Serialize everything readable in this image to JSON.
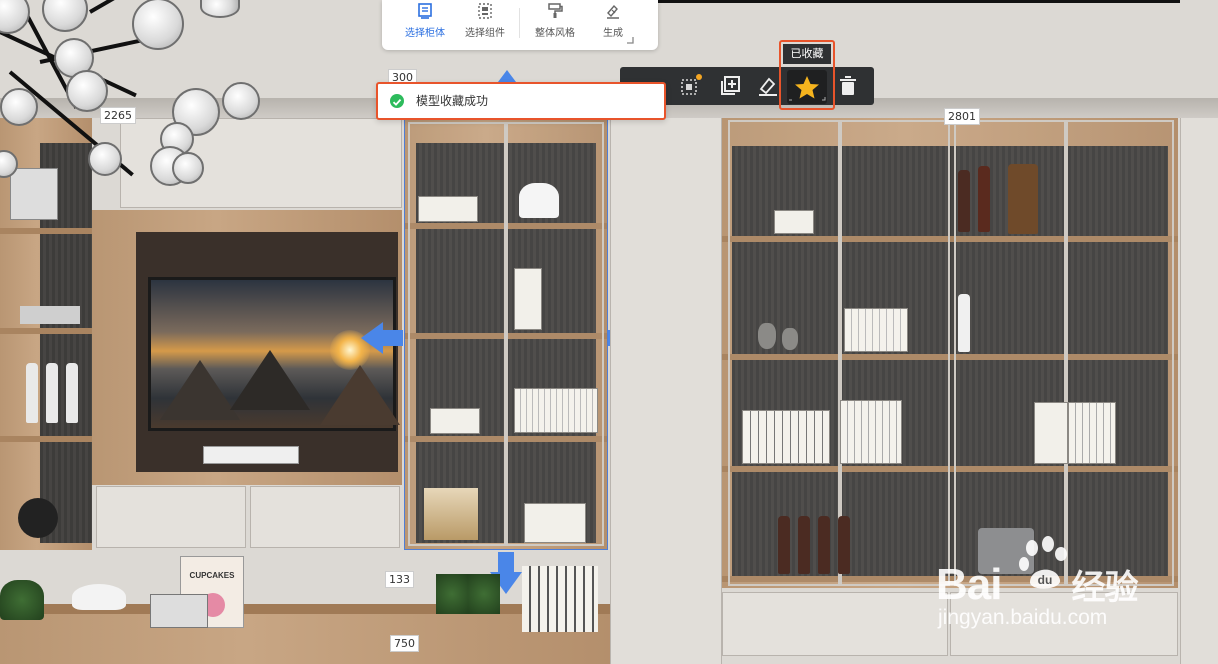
{
  "top_toolbar": {
    "items": [
      {
        "label": "选择柜体",
        "icon": "cabinet-select-icon",
        "active": true
      },
      {
        "label": "选择组件",
        "icon": "component-select-icon",
        "active": false
      },
      {
        "label": "整体风格",
        "icon": "paint-roller-icon",
        "active": false
      },
      {
        "label": "生成",
        "icon": "generate-icon",
        "active": false
      }
    ]
  },
  "float_toolbar": {
    "buttons": [
      "grid-icon",
      "frame-select-icon",
      "add-copy-icon",
      "brush-icon",
      "star-icon",
      "trash-icon"
    ],
    "favorite_tooltip": "已收藏"
  },
  "toast": {
    "message": "模型收藏成功",
    "icon": "check-circle-icon"
  },
  "dimensions": {
    "top_mid": "300",
    "left": "2265",
    "right": "2801",
    "bottom_gap": "133",
    "bottom_width": "750"
  },
  "scene": {
    "book_title": "CUPCAKES"
  },
  "watermark": {
    "brand": "Bai",
    "brand_cn": "经验",
    "brand_suffix": "du",
    "url": "jingyan.baidu.com"
  },
  "colors": {
    "accent_blue": "#2b6fe0",
    "highlight_red": "#e8542b",
    "success_green": "#2dbb5c",
    "star_yellow": "#f5b41e"
  }
}
